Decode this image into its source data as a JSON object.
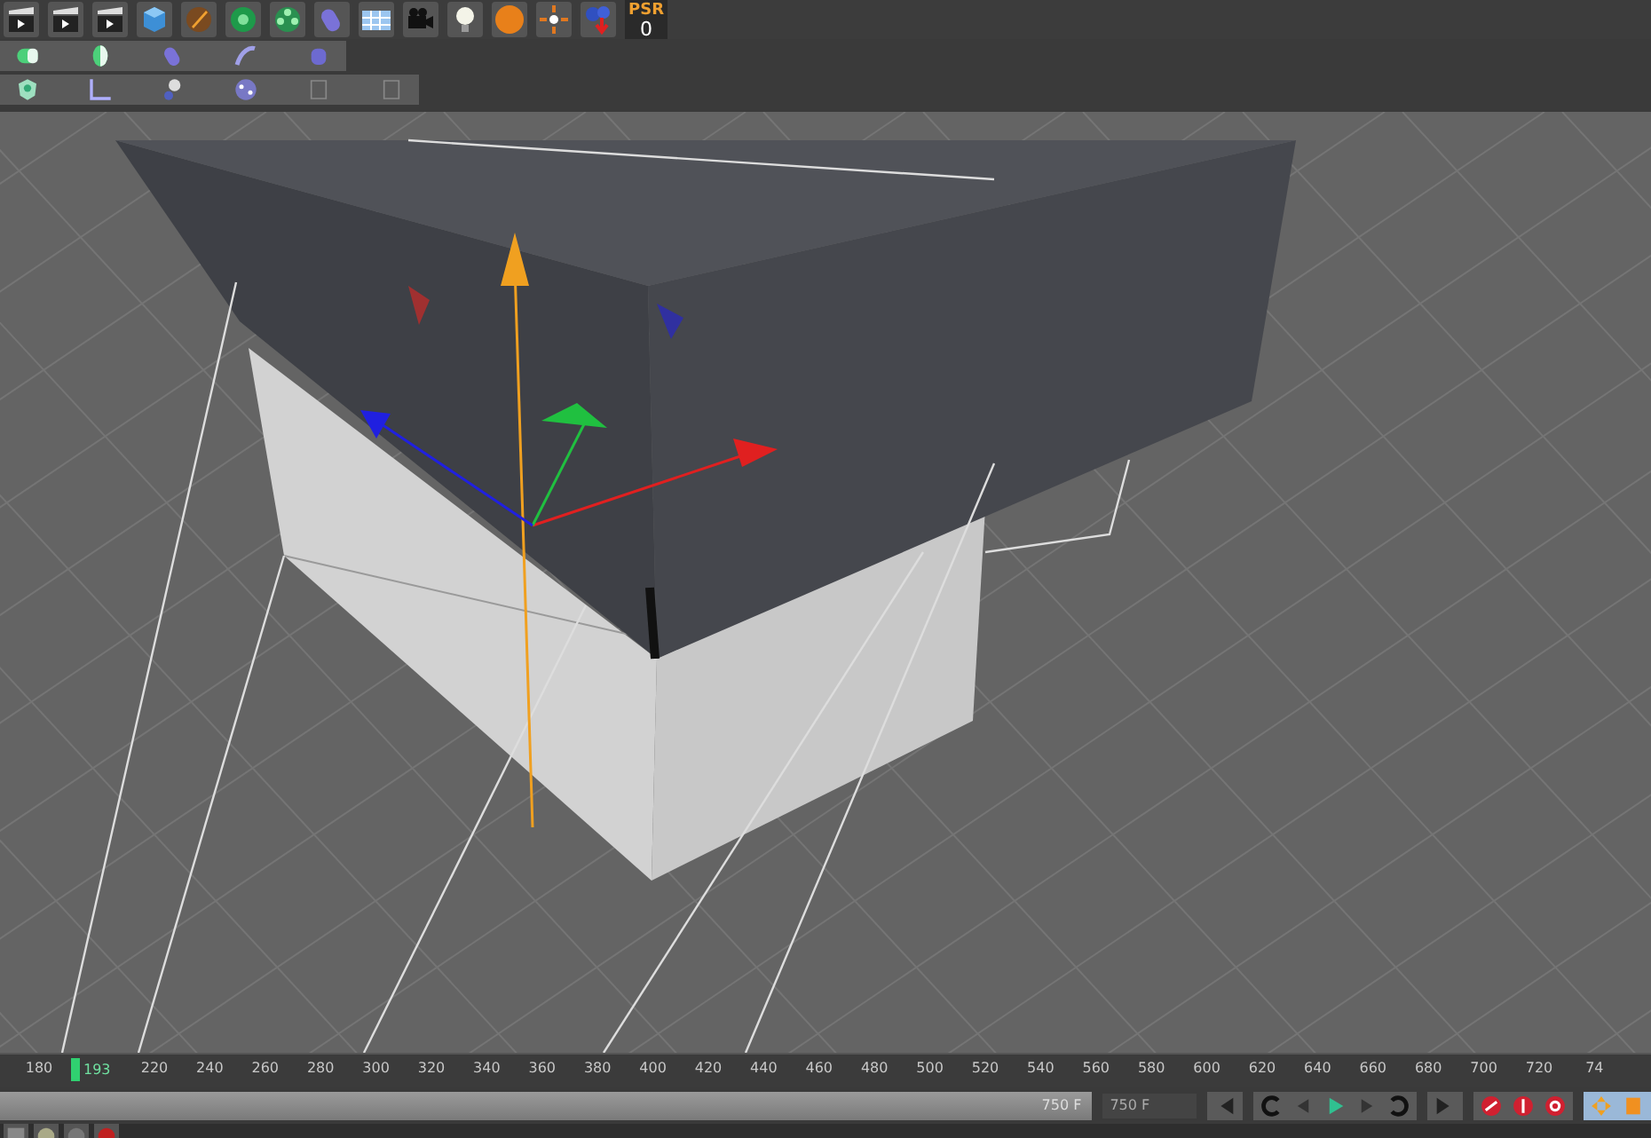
{
  "psr": {
    "label": "PSR",
    "value": "0"
  },
  "timeline": {
    "current_frame": "193",
    "ticks": [
      "180",
      "220",
      "240",
      "260",
      "280",
      "300",
      "320",
      "340",
      "360",
      "380",
      "400",
      "420",
      "440",
      "460",
      "480",
      "500",
      "520",
      "540",
      "560",
      "580",
      "600",
      "620",
      "640",
      "660",
      "680",
      "700",
      "720",
      "74"
    ]
  },
  "range_bar": {
    "end": "750 F",
    "level": 1
  },
  "end_field": {
    "value": "750 F"
  }
}
